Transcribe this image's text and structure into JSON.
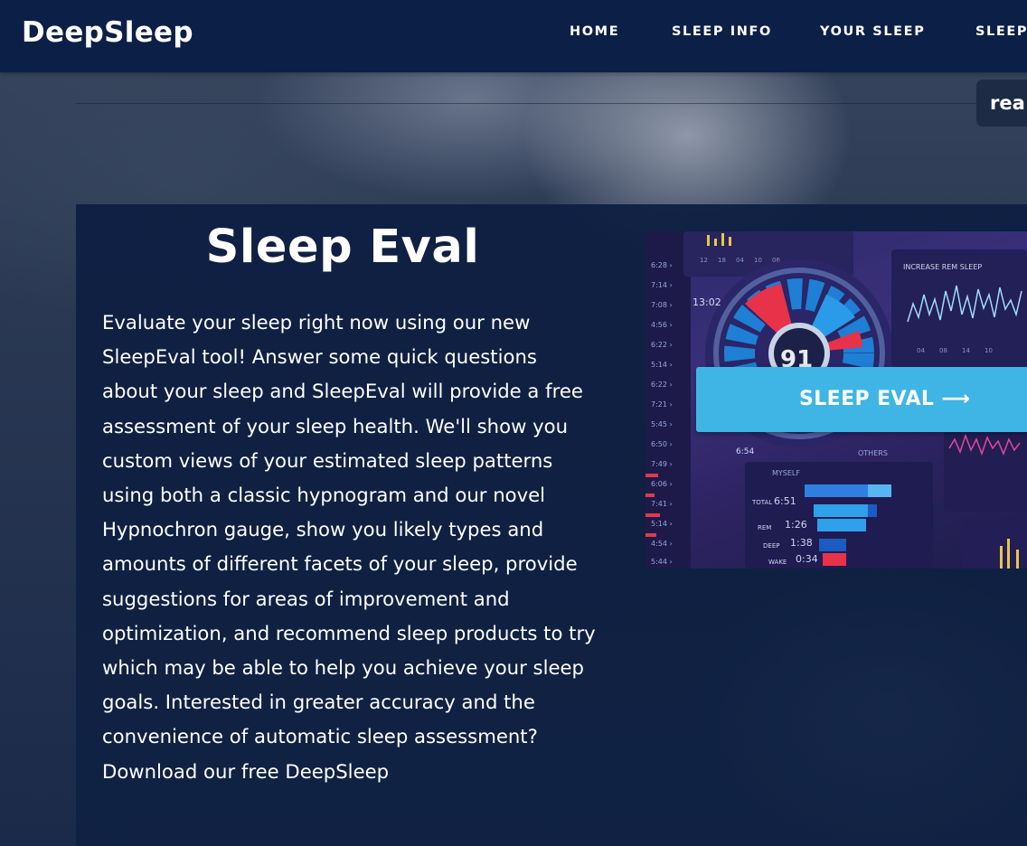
{
  "brand": {
    "name": "DeepSleep"
  },
  "nav": {
    "items": [
      {
        "label": "HOME"
      },
      {
        "label": "SLEEP INFO"
      },
      {
        "label": "YOUR SLEEP"
      },
      {
        "label": "SLEEP"
      }
    ]
  },
  "read_button": {
    "label": "rea"
  },
  "section": {
    "title": "Sleep Eval",
    "body": "Evaluate your sleep right now using our new SleepEval tool! Answer some quick questions about your sleep and SleepEval will provide a free assessment of your sleep health. We'll show you custom views of your estimated sleep patterns using both a classic hypnogram and our novel Hypnochron gauge, show you likely types and amounts of different facets of your sleep, provide suggestions for areas of improvement and optimization, and recommend sleep products to try which may be able to help you achieve your sleep goals. Interested in greater accuracy and the convenience of automatic sleep assessment? Download our free DeepSleep",
    "cta": {
      "label": "SLEEP EVAL",
      "arrow": "⟶"
    }
  },
  "dashboard": {
    "score": "91",
    "time_top": "13:02",
    "chart_title": "INCREASE REM SLEEP",
    "legend": [
      "MYSELF",
      "OTHERS"
    ],
    "rows": [
      {
        "label": "TOTAL",
        "value": "6:51"
      },
      {
        "label": "REM",
        "value": "1:26"
      },
      {
        "label": "DEEP",
        "value": "1:38"
      },
      {
        "label": "WAKE",
        "value": "0:34"
      }
    ],
    "side_small": "6:54"
  },
  "colors": {
    "navbar": "#0c1f47",
    "panel": "#0d1e42",
    "cta": "#3fb5e6"
  }
}
